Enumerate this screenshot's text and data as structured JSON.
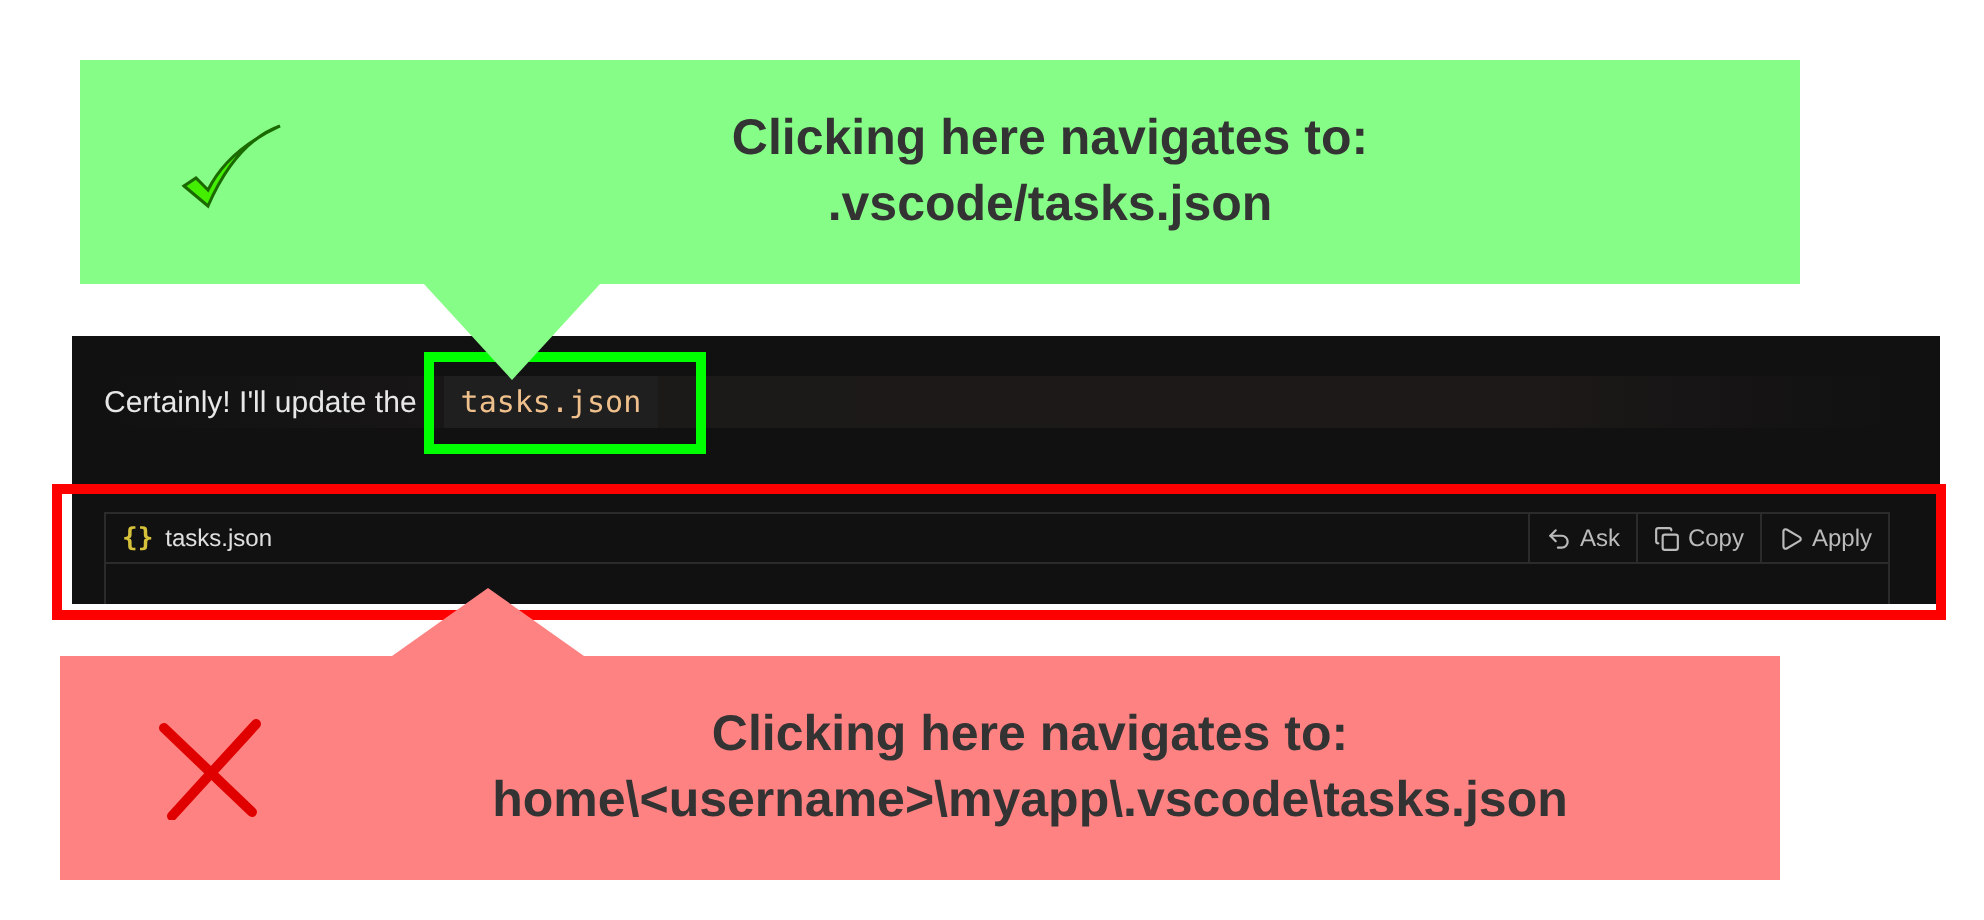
{
  "callout_above": {
    "kind": "correct",
    "lines": [
      "Clicking here navigates to:",
      ".vscode/tasks.json"
    ]
  },
  "chat": {
    "message": "Certainly! I'll update the",
    "file_link": "tasks.json"
  },
  "code_block": {
    "file_icon": "{}",
    "file_name": "tasks.json",
    "actions": [
      {
        "label": "Ask"
      },
      {
        "label": "Copy"
      },
      {
        "label": "Apply"
      }
    ]
  },
  "callout_below": {
    "kind": "wrong",
    "lines": [
      "Clicking here navigates to:",
      "home\\<username>\\myapp\\.vscode\\tasks.json"
    ]
  }
}
